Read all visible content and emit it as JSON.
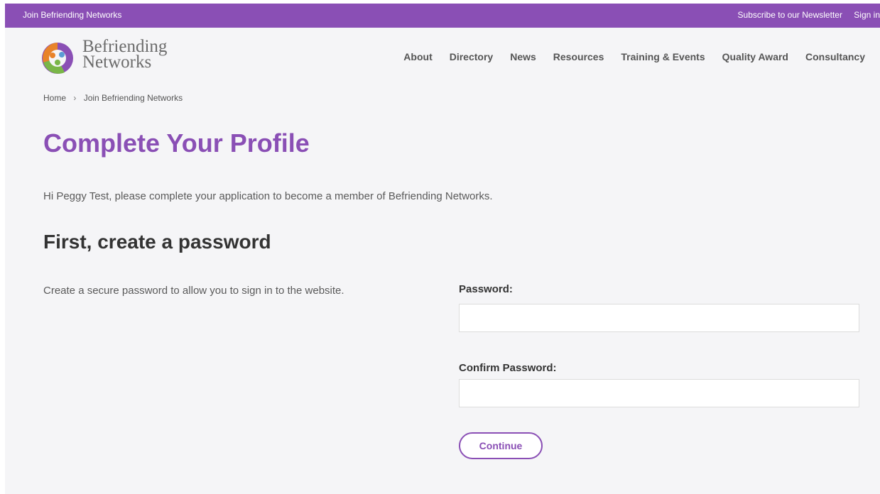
{
  "topbar": {
    "join_label": "Join Befriending Networks",
    "newsletter_label": "Subscribe to our Newsletter",
    "signin_label": "Sign in",
    "color": "#8a4fb5"
  },
  "logo": {
    "line1": "Befriending",
    "line2": "Networks",
    "colors": [
      "#e8832a",
      "#7ab648",
      "#8a4fb5",
      "#5b9bd5"
    ]
  },
  "nav": {
    "items": [
      "About",
      "Directory",
      "News",
      "Resources",
      "Training & Events",
      "Quality Award",
      "Consultancy"
    ]
  },
  "breadcrumb": {
    "home": "Home",
    "separator": "›",
    "current": "Join Befriending Networks"
  },
  "page": {
    "title": "Complete Your Profile",
    "intro": "Hi Peggy Test, please complete your application to become a member of Befriending Networks."
  },
  "section": {
    "title": "First, create a password",
    "description": "Create a secure password to allow you to sign in to the website."
  },
  "form": {
    "password_label": "Password:",
    "password_value": "",
    "confirm_label": "Confirm Password:",
    "confirm_value": "",
    "continue_label": "Continue"
  }
}
